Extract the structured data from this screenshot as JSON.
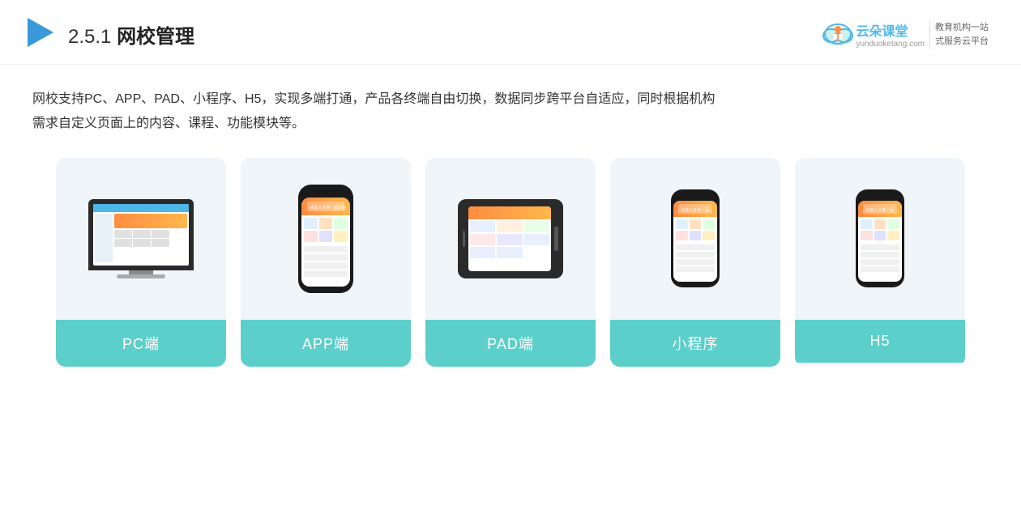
{
  "header": {
    "section_number": "2.5.1",
    "title": "网校管理",
    "brand": {
      "name": "云朵课堂",
      "website": "yunduoketang.com",
      "tagline_line1": "教育机构一站",
      "tagline_line2": "式服务云平台"
    }
  },
  "description": {
    "text_line1": "网校支持PC、APP、PAD、小程序、H5，实现多端打通，产品各终端自由切换，数据同步跨平台自适应，同时根据机构",
    "text_line2": "需求自定义页面上的内容、课程、功能模块等。"
  },
  "cards": [
    {
      "id": "pc",
      "label": "PC端",
      "device_type": "desktop"
    },
    {
      "id": "app",
      "label": "APP端",
      "device_type": "phone"
    },
    {
      "id": "pad",
      "label": "PAD端",
      "device_type": "tablet"
    },
    {
      "id": "miniprogram",
      "label": "小程序",
      "device_type": "phone_mini"
    },
    {
      "id": "h5",
      "label": "H5",
      "device_type": "phone_h5"
    }
  ],
  "colors": {
    "card_label_bg": "#5dcfca",
    "header_accent": "#3a9ad9",
    "brand_blue": "#4db8e8",
    "text_dark": "#333333",
    "card_bg": "#f0f5fa"
  }
}
